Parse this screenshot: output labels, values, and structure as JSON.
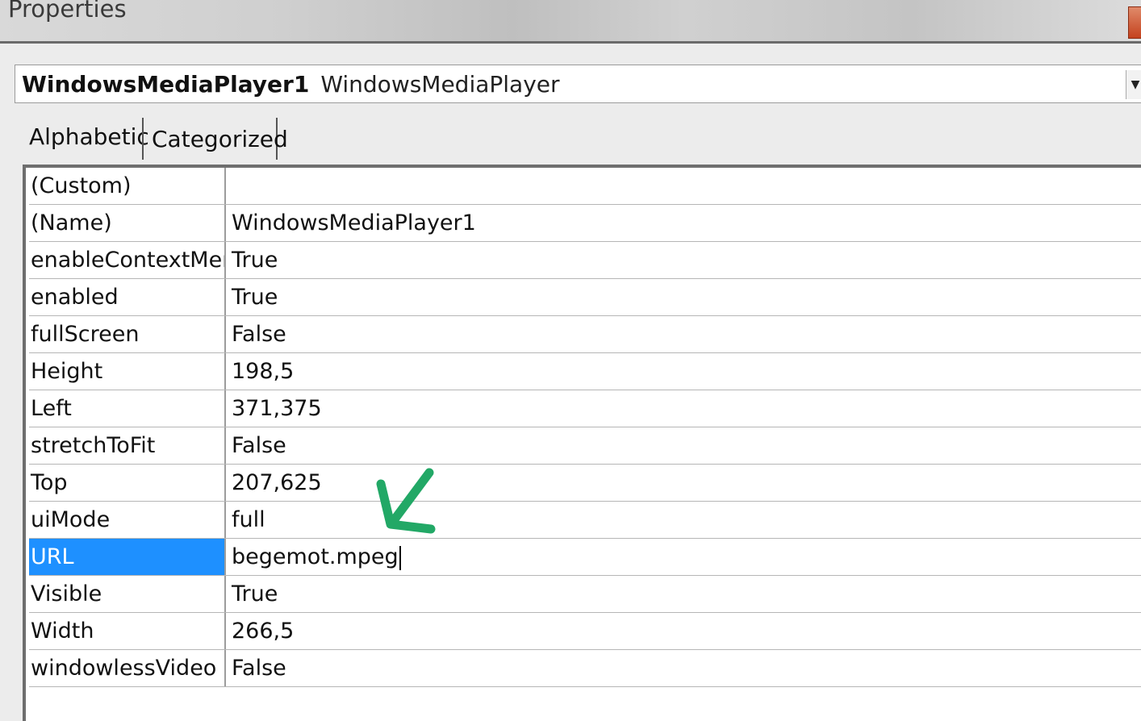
{
  "window": {
    "title": "Properties"
  },
  "object_selector": {
    "name": "WindowsMediaPlayer1",
    "type": "WindowsMediaPlayer"
  },
  "tabs": [
    {
      "label": "Alphabetic",
      "active": true
    },
    {
      "label": "Categorized",
      "active": false
    }
  ],
  "properties": [
    {
      "name": "(Custom)",
      "value": ""
    },
    {
      "name": "(Name)",
      "value": "WindowsMediaPlayer1"
    },
    {
      "name": "enableContextMenu",
      "value": "True"
    },
    {
      "name": "enabled",
      "value": "True"
    },
    {
      "name": "fullScreen",
      "value": "False"
    },
    {
      "name": "Height",
      "value": "198,5"
    },
    {
      "name": "Left",
      "value": "371,375"
    },
    {
      "name": "stretchToFit",
      "value": "False"
    },
    {
      "name": "Top",
      "value": "207,625"
    },
    {
      "name": "uiMode",
      "value": "full"
    },
    {
      "name": "URL",
      "value": "begemot.mpeg",
      "selected": true
    },
    {
      "name": "Visible",
      "value": "True"
    },
    {
      "name": "Width",
      "value": "266,5"
    },
    {
      "name": "windowlessVideo",
      "value": "False"
    }
  ],
  "colors": {
    "selection": "#1e90ff",
    "annotation": "#22a866"
  },
  "annotation": {
    "icon": "green-check-arrow-icon"
  }
}
